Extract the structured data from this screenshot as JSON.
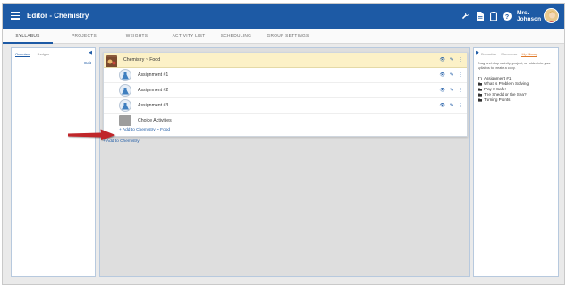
{
  "header": {
    "title": "Editor - Chemistry",
    "user_name_line1": "Mrs.",
    "user_name_line2": "Johnson",
    "icons": [
      "wrench-icon",
      "document-icon",
      "clipboard-icon",
      "help-icon"
    ]
  },
  "tabs": [
    {
      "label": "SYLLABUS",
      "active": true
    },
    {
      "label": "PROJECTS",
      "active": false
    },
    {
      "label": "WEIGHTS",
      "active": false
    },
    {
      "label": "ACTIVITY LIST",
      "active": false
    },
    {
      "label": "SCHEDULING",
      "active": false
    },
    {
      "label": "GROUP SETTINGS",
      "active": false
    }
  ],
  "left_panel": {
    "tabs": [
      "Overview",
      "Badges"
    ],
    "edit_label": "Edit"
  },
  "syllabus": {
    "folder_label": "Chemistry ~ Food",
    "items": [
      {
        "label": "Assignment #1"
      },
      {
        "label": "Assignment #2"
      },
      {
        "label": "Assignment #3"
      }
    ],
    "choice_label": "Choice Activities",
    "add_in_folder": "Add to Chemistry ~ Food",
    "add_to_course": "Add to Chemistry"
  },
  "right_panel": {
    "tabs": [
      "Properties",
      "Resources",
      "My Library"
    ],
    "help_text": "Drag and drop activity, project, or folder into your syllabus to create a copy.",
    "library_items": [
      {
        "label": "Assignment #1",
        "icon": "document-icon"
      },
      {
        "label": "What is Problem Solving",
        "icon": "folder-icon"
      },
      {
        "label": "Play It Safe!",
        "icon": "folder-icon"
      },
      {
        "label": "The Shedd or the Sea?",
        "icon": "folder-icon"
      },
      {
        "label": "Turning Points",
        "icon": "folder-icon"
      }
    ]
  },
  "colors": {
    "header_bg": "#1d5aa5",
    "folder_highlight": "#fcf1c7",
    "link": "#1d5aa5",
    "annotation_arrow": "#c0252a",
    "active_library_tab": "#e07b2c"
  }
}
